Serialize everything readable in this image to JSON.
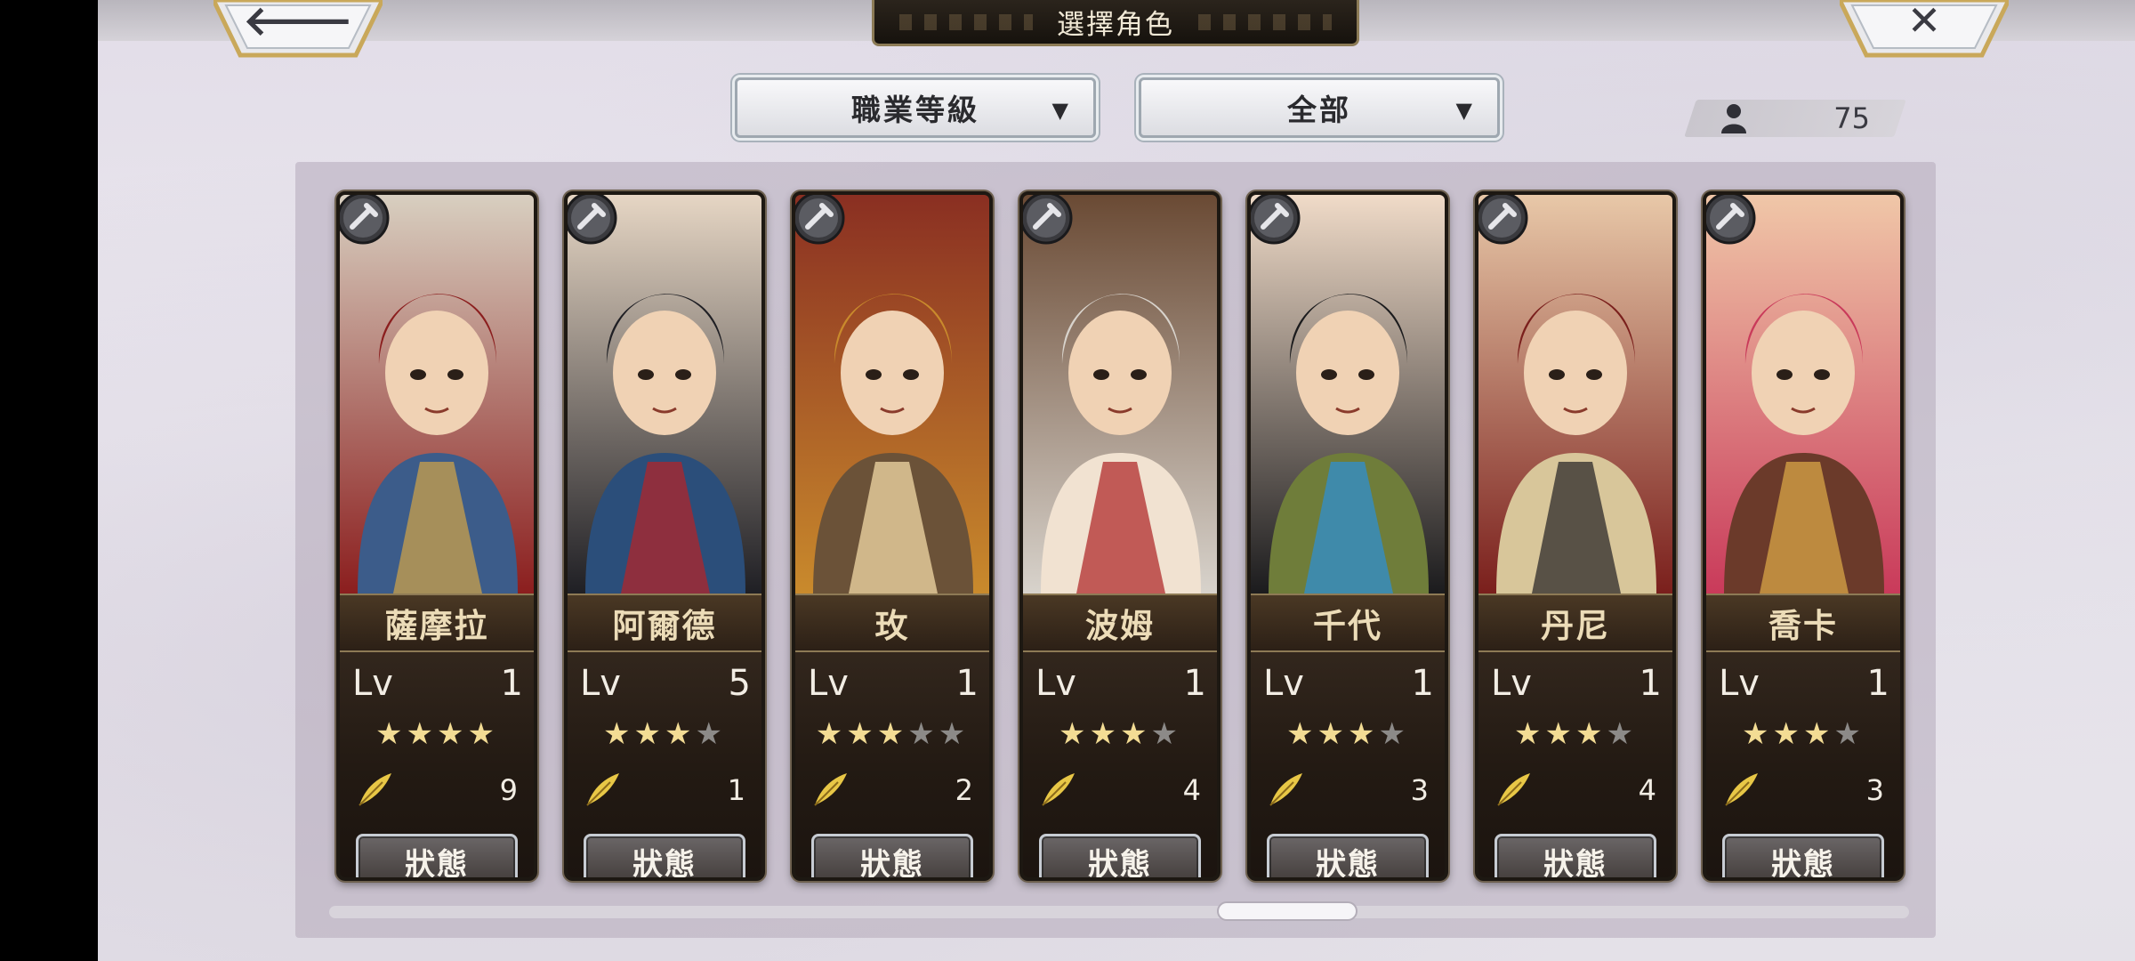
{
  "header": {
    "title": "選擇角色",
    "back_icon": "arrow-left-icon",
    "close_icon": "close-icon",
    "back_glyph": "🡐",
    "close_glyph": "✕"
  },
  "filters": {
    "job_level": "職業等級",
    "category": "全部",
    "caret": "▼"
  },
  "character_count": "75",
  "status_label": "狀態",
  "lv_label": "Lv",
  "characters": [
    {
      "name": "薩摩拉",
      "level": "1",
      "stars": 4,
      "max_stars": 4,
      "fragments": "9",
      "class_icon": "hammer-icon"
    },
    {
      "name": "阿爾德",
      "level": "5",
      "stars": 3,
      "max_stars": 4,
      "fragments": "1",
      "class_icon": "sword-icon"
    },
    {
      "name": "玫",
      "level": "1",
      "stars": 3,
      "max_stars": 5,
      "fragments": "2",
      "class_icon": "hammer-icon"
    },
    {
      "name": "波姆",
      "level": "1",
      "stars": 3,
      "max_stars": 4,
      "fragments": "4",
      "class_icon": "fist-icon"
    },
    {
      "name": "千代",
      "level": "1",
      "stars": 3,
      "max_stars": 4,
      "fragments": "3",
      "class_icon": "fist-icon"
    },
    {
      "name": "丹尼",
      "level": "1",
      "stars": 3,
      "max_stars": 4,
      "fragments": "4",
      "class_icon": "axe-icon"
    },
    {
      "name": "喬卡",
      "level": "1",
      "stars": 3,
      "max_stars": 4,
      "fragments": "3",
      "class_icon": "axe-icon"
    }
  ],
  "colors": {
    "accent_gold": "#f3dc94",
    "card_dark": "#231a13",
    "name_text": "#ecdcb8"
  }
}
